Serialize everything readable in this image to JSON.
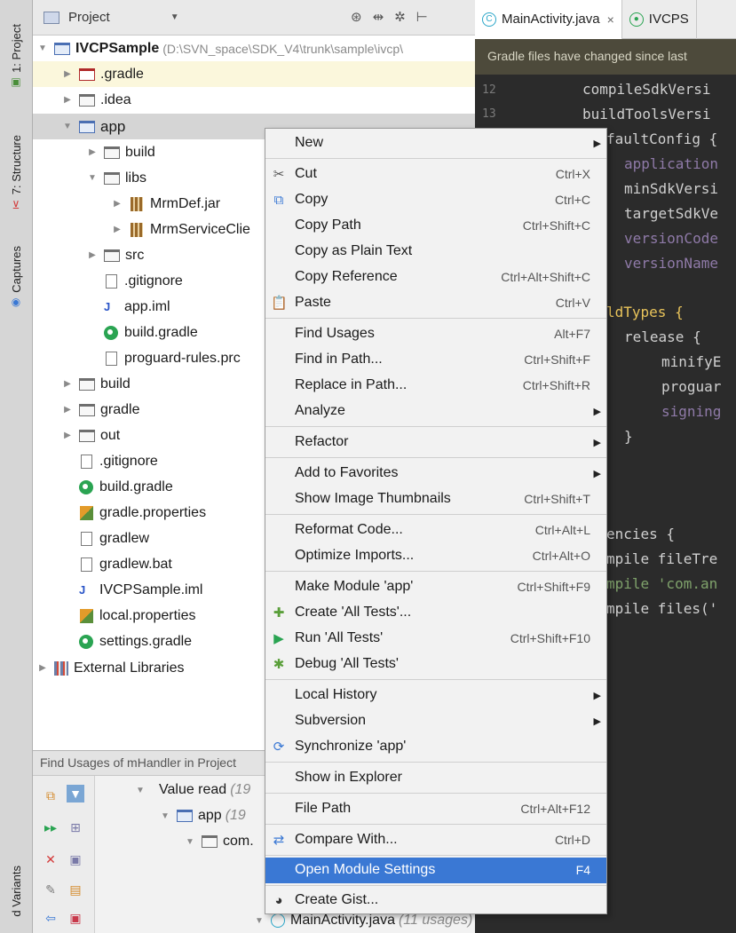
{
  "left_strip": {
    "tabs": [
      "1: Project",
      "7: Structure",
      "Captures",
      "d Variants"
    ]
  },
  "project_panel": {
    "header_label": "Project",
    "tree": [
      {
        "name": "IVCPSample",
        "path": "(D:\\SVN_space\\SDK_V4\\trunk\\sample\\ivcp\\",
        "icon": "module-folder-icon"
      },
      {
        "name": ".gradle",
        "icon": "folder-red-icon"
      },
      {
        "name": ".idea",
        "icon": "folder-icon"
      },
      {
        "name": "app",
        "icon": "module-folder-icon"
      },
      {
        "name": "build",
        "icon": "folder-icon"
      },
      {
        "name": "libs",
        "icon": "folder-icon"
      },
      {
        "name": "MrmDef.jar",
        "icon": "jar-icon"
      },
      {
        "name": "MrmServiceClie",
        "icon": "jar-icon"
      },
      {
        "name": "src",
        "icon": "folder-icon"
      },
      {
        "name": ".gitignore",
        "icon": "file-icon"
      },
      {
        "name": "app.iml",
        "icon": "iml-icon"
      },
      {
        "name": "build.gradle",
        "icon": "gradle-icon"
      },
      {
        "name": "proguard-rules.prc",
        "icon": "file-icon"
      },
      {
        "name": "build",
        "icon": "folder-icon"
      },
      {
        "name": "gradle",
        "icon": "folder-icon"
      },
      {
        "name": "out",
        "icon": "folder-icon"
      },
      {
        "name": ".gitignore",
        "icon": "file-icon"
      },
      {
        "name": "build.gradle",
        "icon": "gradle-icon"
      },
      {
        "name": "gradle.properties",
        "icon": "properties-icon"
      },
      {
        "name": "gradlew",
        "icon": "file-icon"
      },
      {
        "name": "gradlew.bat",
        "icon": "file-icon"
      },
      {
        "name": "IVCPSample.iml",
        "icon": "iml-icon"
      },
      {
        "name": "local.properties",
        "icon": "properties-icon"
      },
      {
        "name": "settings.gradle",
        "icon": "gradle-icon"
      },
      {
        "name": "External Libraries",
        "icon": "libraries-icon"
      }
    ]
  },
  "find_panel": {
    "header": "Find Usages of mHandler in Project",
    "rows": [
      {
        "label": "Value read",
        "note": "(19"
      },
      {
        "label": "app",
        "note": "(19"
      },
      {
        "label": "com."
      },
      {
        "label": "MainActivity.java",
        "note": "(11 usages)"
      }
    ]
  },
  "editor": {
    "tabs": [
      {
        "label": "MainActivity.java",
        "close": "×"
      },
      {
        "label": "IVCPS"
      }
    ],
    "notice": "Gradle files have changed since last",
    "gutter": [
      "12",
      "13"
    ],
    "code": [
      "compileSdkVersi",
      "buildToolsVersi",
      "faultConfig {",
      "application",
      "minSdkVersi",
      "targetSdkVe",
      "versionCode",
      "versionName",
      "ldTypes {",
      "release {",
      "minifyE",
      "proguar",
      "signing",
      "}",
      "encies {",
      "mpile fileTre",
      "mpile 'com.an",
      "mpile files('"
    ]
  },
  "context_menu": {
    "items": [
      {
        "label": "New",
        "shortcut": "",
        "submenu": true
      },
      {
        "label": "Cut",
        "shortcut": "Ctrl+X",
        "icon": "cut-icon"
      },
      {
        "label": "Copy",
        "shortcut": "Ctrl+C",
        "icon": "copy-icon"
      },
      {
        "label": "Copy Path",
        "shortcut": "Ctrl+Shift+C"
      },
      {
        "label": "Copy as Plain Text",
        "shortcut": ""
      },
      {
        "label": "Copy Reference",
        "shortcut": "Ctrl+Alt+Shift+C"
      },
      {
        "label": "Paste",
        "shortcut": "Ctrl+V",
        "icon": "paste-icon"
      },
      {
        "label": "Find Usages",
        "shortcut": "Alt+F7"
      },
      {
        "label": "Find in Path...",
        "shortcut": "Ctrl+Shift+F"
      },
      {
        "label": "Replace in Path...",
        "shortcut": "Ctrl+Shift+R"
      },
      {
        "label": "Analyze",
        "shortcut": "",
        "submenu": true
      },
      {
        "label": "Refactor",
        "shortcut": "",
        "submenu": true
      },
      {
        "label": "Add to Favorites",
        "shortcut": "",
        "submenu": true
      },
      {
        "label": "Show Image Thumbnails",
        "shortcut": "Ctrl+Shift+T"
      },
      {
        "label": "Reformat Code...",
        "shortcut": "Ctrl+Alt+L"
      },
      {
        "label": "Optimize Imports...",
        "shortcut": "Ctrl+Alt+O"
      },
      {
        "label": "Make Module 'app'",
        "shortcut": "Ctrl+Shift+F9"
      },
      {
        "label": "Create 'All Tests'...",
        "shortcut": "",
        "icon": "create-test-icon"
      },
      {
        "label": "Run 'All Tests'",
        "shortcut": "Ctrl+Shift+F10",
        "icon": "run-icon"
      },
      {
        "label": "Debug 'All Tests'",
        "shortcut": "",
        "icon": "debug-icon"
      },
      {
        "label": "Local History",
        "shortcut": "",
        "submenu": true
      },
      {
        "label": "Subversion",
        "shortcut": "",
        "submenu": true
      },
      {
        "label": "Synchronize 'app'",
        "shortcut": "",
        "icon": "sync-icon"
      },
      {
        "label": "Show in Explorer",
        "shortcut": ""
      },
      {
        "label": "File Path",
        "shortcut": "Ctrl+Alt+F12"
      },
      {
        "label": "Compare With...",
        "shortcut": "Ctrl+D",
        "icon": "compare-icon"
      },
      {
        "label": "Open Module Settings",
        "shortcut": "F4",
        "active": true
      },
      {
        "label": "Create Gist...",
        "shortcut": "",
        "icon": "github-icon"
      }
    ]
  },
  "colors": {
    "menu_active": "#3a78d4",
    "editor_bg": "#2b2b2b",
    "highlight_row": "#fbf7dc"
  }
}
